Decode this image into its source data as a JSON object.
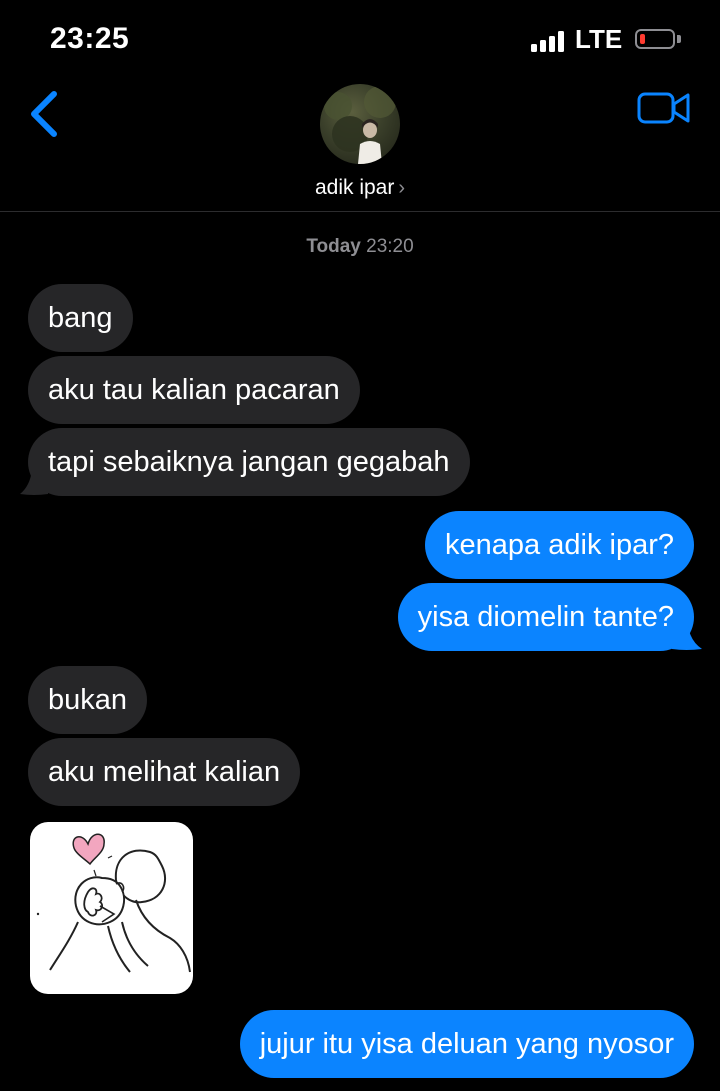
{
  "status_bar": {
    "time": "23:25",
    "network": "LTE",
    "battery_level": 0.15,
    "signal_bars": 4
  },
  "nav": {
    "back_icon": "chevron-left-icon",
    "video_icon": "video-camera-icon",
    "contact_name": "adik ipar",
    "chevron": "›"
  },
  "timestamp": {
    "day": "Today",
    "time": "23:20"
  },
  "messages": [
    {
      "direction": "incoming",
      "text": "bang"
    },
    {
      "direction": "incoming",
      "text": "aku tau kalian pacaran"
    },
    {
      "direction": "incoming",
      "text": "tapi sebaiknya jangan gegabah"
    },
    {
      "direction": "outgoing",
      "text": "kenapa adik ipar?"
    },
    {
      "direction": "outgoing",
      "text": "yisa diomelin tante?"
    },
    {
      "direction": "incoming",
      "text": "bukan"
    },
    {
      "direction": "incoming",
      "text": "aku melihat kalian"
    },
    {
      "direction": "incoming",
      "type": "sticker",
      "icon": "kiss-sticker-image"
    },
    {
      "direction": "outgoing",
      "text": "jujur itu yisa deluan yang nyosor"
    }
  ],
  "colors": {
    "outgoing_bubble": "#0b84ff",
    "incoming_bubble": "#262628",
    "accent": "#0a84ff",
    "background": "#000000",
    "secondary_text": "#8e8e93",
    "battery_low": "#ff3b30"
  }
}
